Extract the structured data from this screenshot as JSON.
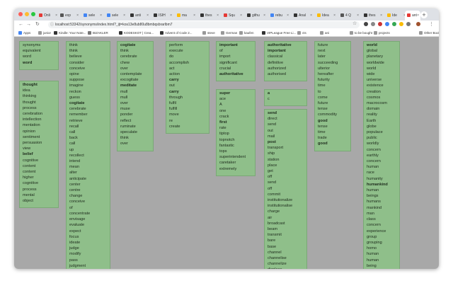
{
  "tabs": [
    {
      "label": "Onli",
      "active": false
    },
    {
      "label": "exp",
      "active": false
    },
    {
      "label": "sele",
      "active": false
    },
    {
      "label": "sele",
      "active": false
    },
    {
      "label": "anti",
      "active": false
    },
    {
      "label": "ISIH",
      "active": false
    },
    {
      "label": "ma",
      "active": false
    },
    {
      "label": "thes",
      "active": false
    },
    {
      "label": "Squ",
      "active": false
    },
    {
      "label": "githu",
      "active": false
    },
    {
      "label": "rebu",
      "active": false
    },
    {
      "label": "Anal",
      "active": false
    },
    {
      "label": "Idea",
      "active": false
    },
    {
      "label": "4 Q",
      "active": false
    },
    {
      "label": "thes",
      "active": false
    },
    {
      "label": "Ide",
      "active": false
    },
    {
      "label": "ant",
      "active": true
    }
  ],
  "url": "localhost:53342/synonyms/index.html?_ijt=kos13e8ub80u8bmbqsbrarlbm7",
  "bookmarks": [
    {
      "label": "Apps"
    },
    {
      "label": "junior"
    },
    {
      "label": "Kindle: Your Note..."
    },
    {
      "label": "BIZAKLER"
    },
    {
      "label": "KODESKOT | Crea..."
    },
    {
      "label": "Advent of Code 2..."
    },
    {
      "label": "steve"
    },
    {
      "label": "German"
    },
    {
      "label": "kaufen"
    },
    {
      "label": "VIPLeague Free Li..."
    },
    {
      "label": "cts"
    },
    {
      "label": "ani"
    },
    {
      "label": "to be bought"
    },
    {
      "label": "projects"
    },
    {
      "label": "Other Bookmarks"
    }
  ],
  "groups": [
    {
      "words": [
        "synonyms",
        "equivalent",
        "word",
        "word"
      ],
      "bold": [
        3
      ]
    },
    {
      "words": [
        "thought",
        "idea",
        "thinking",
        "thought",
        "process",
        "cerebration",
        "intellection",
        "mentation",
        "opinion",
        "sentiment",
        "persuasion",
        "view",
        "belief",
        "cognitive",
        "content",
        "content",
        "higher",
        "cognitive",
        "process",
        "mental",
        "object"
      ],
      "bold": [
        0,
        12
      ]
    },
    {
      "words": [
        "think",
        "think",
        "believe",
        "consider",
        "conceive",
        "opine",
        "suppose",
        "imagine",
        "reckon",
        "guess",
        "cogitate",
        "cerebrate",
        "remember",
        "retrieve",
        "recall",
        "call",
        "back",
        "call",
        "up",
        "recollect",
        "intend",
        "mean",
        "alter",
        "anticipate",
        "center",
        "centre",
        "change",
        "conceive",
        "of",
        "concentrate",
        "envisage",
        "evaluate",
        "expect",
        "focus",
        "ideate",
        "judge",
        "modify",
        "pass",
        "judgment"
      ],
      "bold": [
        10
      ]
    },
    {
      "words": [
        "cogitate",
        "think",
        "cerebrate",
        "chew",
        "over",
        "contemplate",
        "excogitate",
        "meditate",
        "mull",
        "mull",
        "over",
        "muse",
        "ponder",
        "reflect",
        "ruminate",
        "speculate",
        "think",
        "over"
      ],
      "bold": [
        0,
        7
      ]
    },
    {
      "words": [
        "perform",
        "execute",
        "do",
        "accomplish",
        "act",
        "action",
        "carry",
        "out",
        "carry",
        "through",
        "fulfil",
        "fulfill",
        "move",
        "re",
        "create"
      ],
      "bold": [
        6,
        8
      ]
    },
    {
      "words": [
        "important",
        "of",
        "import",
        "significant",
        "crucial",
        "authoritative"
      ],
      "bold": [
        0,
        5
      ]
    },
    {
      "words": [
        "super",
        "ace",
        "A",
        "one",
        "crack",
        "first",
        "rate",
        "tiptop",
        "topnotch",
        "fantastic",
        "tops",
        "superintendent",
        "caretaker",
        "extremely"
      ],
      "bold": [
        0,
        5
      ]
    },
    {
      "words": [
        "authoritative",
        "important",
        "classical",
        "definitive",
        "authorized",
        "authorised"
      ],
      "bold": [
        0,
        1
      ]
    },
    {
      "words": [
        "a",
        "c"
      ],
      "bold": [
        0
      ]
    },
    {
      "words": [
        "send",
        "direct",
        "send",
        "out",
        "mail",
        "post",
        "transport",
        "ship",
        "station",
        "place",
        "get",
        "off",
        "send",
        "off",
        "commit",
        "institutionalize",
        "institutionalise",
        "charge",
        "air",
        "broadcast",
        "beam",
        "transmit",
        "bare",
        "base",
        "channel",
        "channelise",
        "channelize",
        "displace"
      ],
      "bold": [
        0,
        5
      ]
    },
    {
      "words": [
        "future",
        "next",
        "later",
        "succeeding",
        "ulterior",
        "hereafter",
        "futurity",
        "time",
        "to",
        "come",
        "future",
        "tense",
        "commodity",
        "good",
        "tense",
        "time",
        "trade",
        "good"
      ],
      "bold": [
        13,
        17
      ]
    },
    {
      "words": [
        "world",
        "global",
        "planetary",
        "worldwide",
        "world",
        "wide",
        "universe",
        "existence",
        "creation",
        "cosmos",
        "macrocosm",
        "domain",
        "reality",
        "Earth",
        "globe",
        "populace",
        "public",
        "worldly",
        "concern",
        "earthly",
        "concern",
        "human",
        "race",
        "humanity",
        "humankind",
        "human",
        "beings",
        "humans",
        "mankind",
        "man",
        "class",
        "concern",
        "experience",
        "group",
        "grouping",
        "homo",
        "human",
        "human",
        "being"
      ],
      "bold": [
        0,
        24
      ]
    }
  ]
}
